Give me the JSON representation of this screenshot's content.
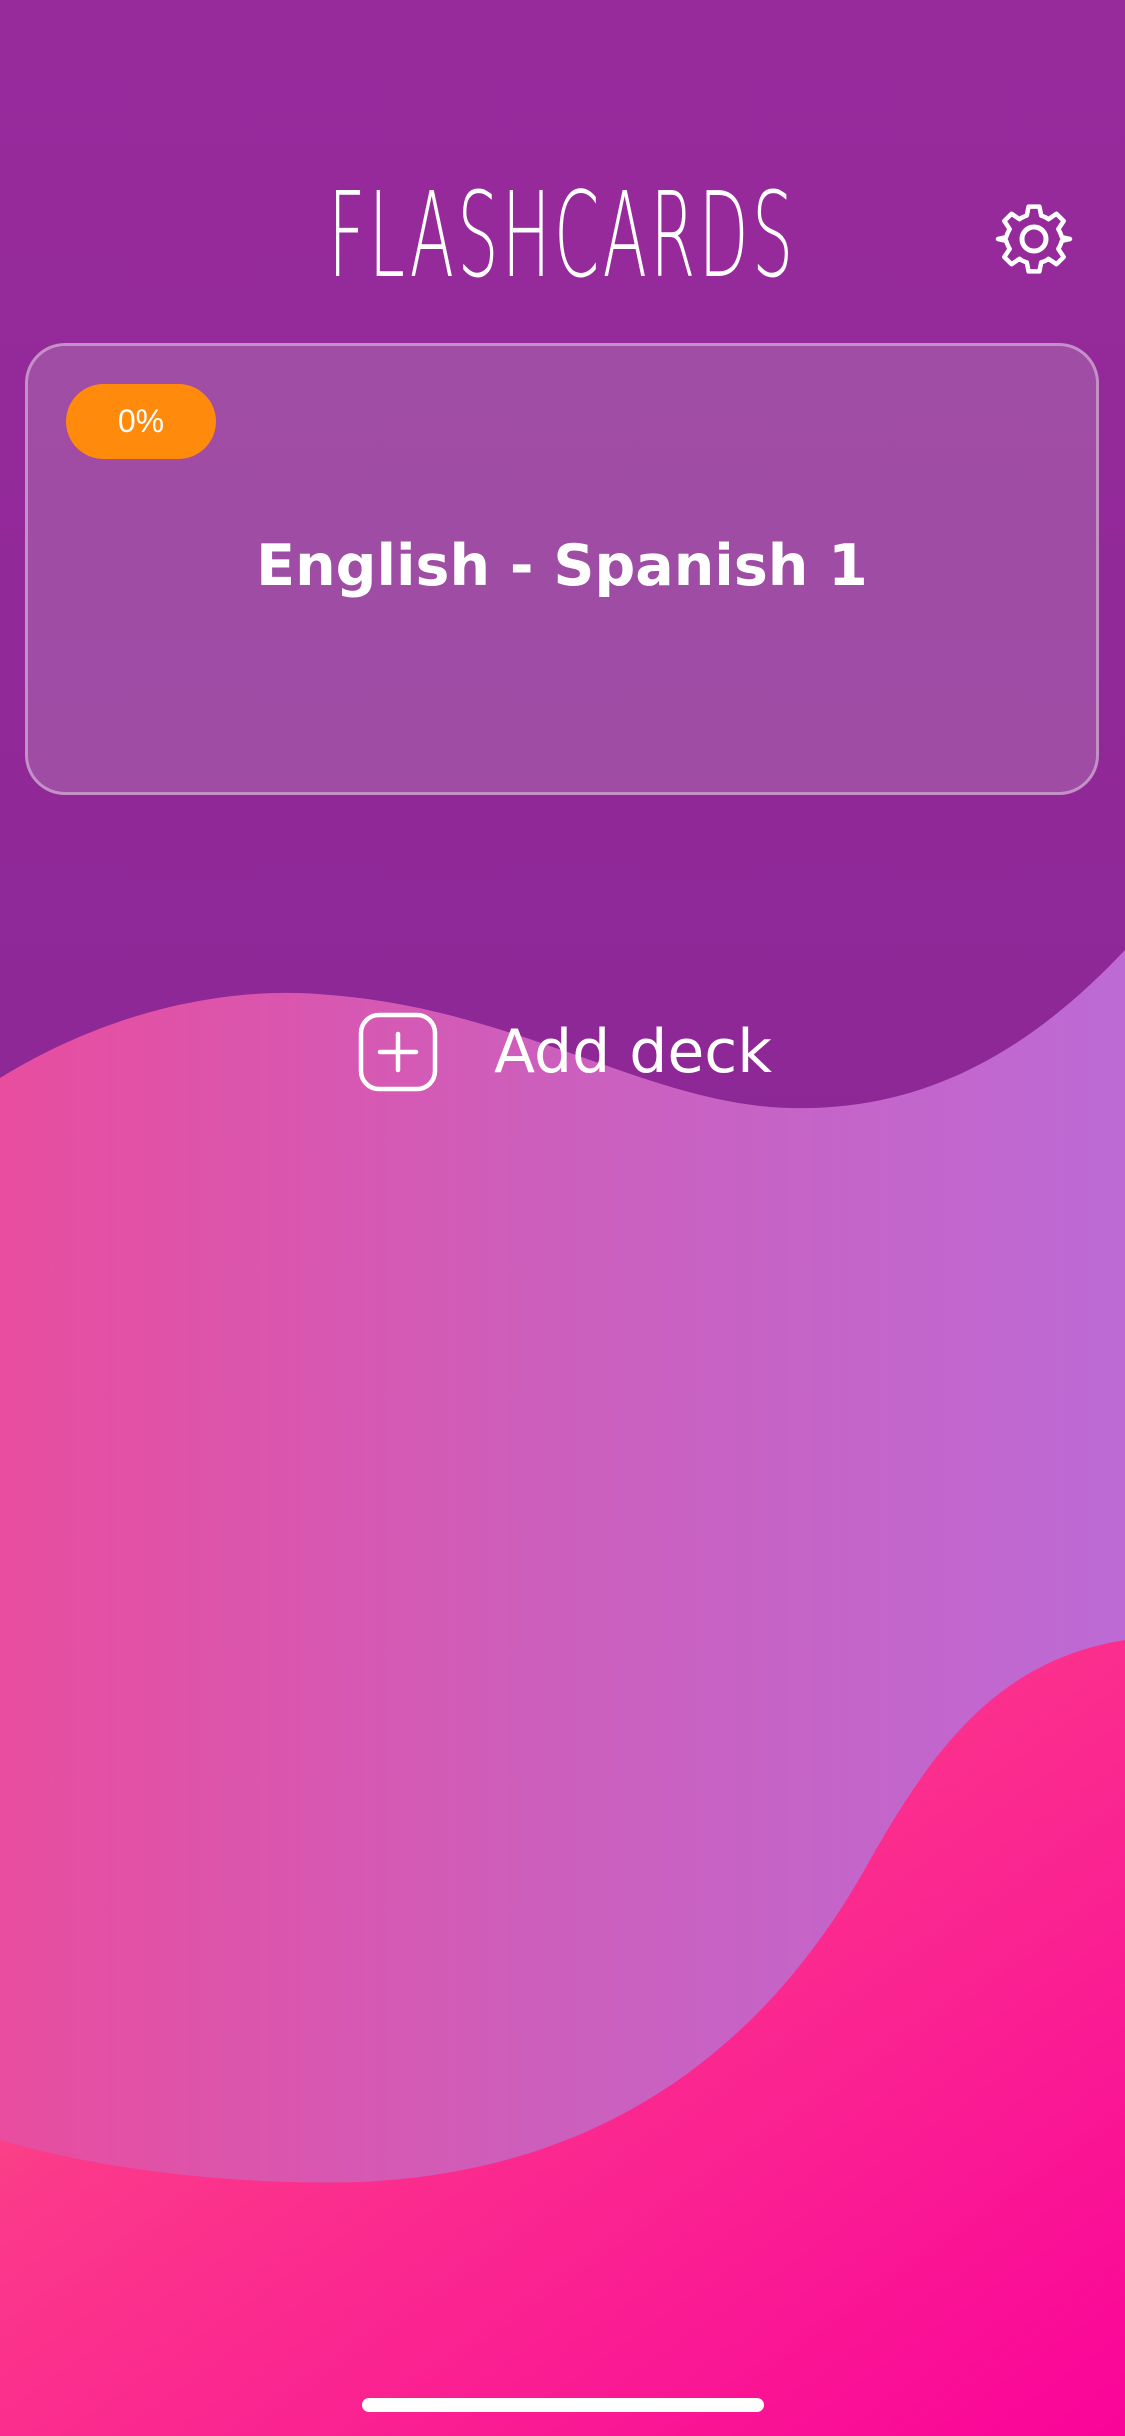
{
  "app": {
    "title": "FLASHCARDS"
  },
  "header": {
    "settings_icon": "gear-icon"
  },
  "decks": [
    {
      "name": "English - Spanish 1",
      "progress_label": "0%",
      "progress": 0
    }
  ],
  "actions": {
    "add_deck_label": "Add deck",
    "add_deck_icon": "plus-square-icon"
  },
  "colors": {
    "background_top": "#992a9c",
    "wave_pink": "#e84d9f",
    "wave_lavender": "#bd6ad5",
    "wave_hot_pink": "#fa0499",
    "wave_coral": "#ff7a6a",
    "badge": "#ff8a0c",
    "text": "#ffffff"
  }
}
